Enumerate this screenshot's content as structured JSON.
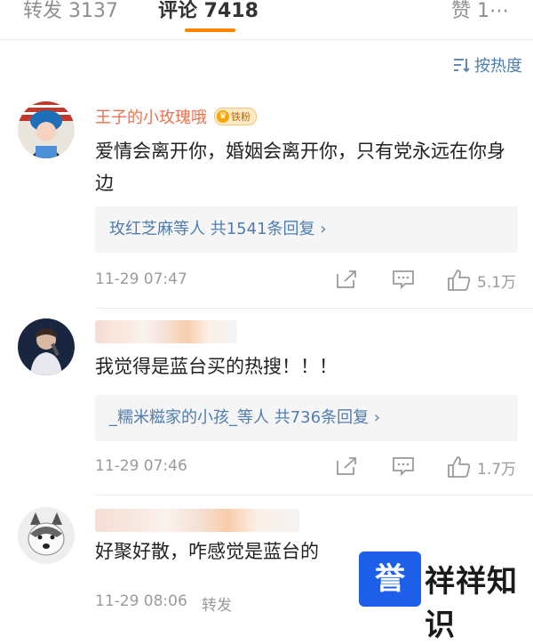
{
  "tabs": [
    {
      "label": "转发 3137"
    },
    {
      "label": "评论 7418"
    },
    {
      "label": "赞 1⋯"
    }
  ],
  "sort": {
    "label": "按热度"
  },
  "comments": [
    {
      "user": "王子的小玫瑰哦",
      "badge": "铁粉",
      "text": "爱情会离开你，婚姻会离开你，只有党永远在你身边",
      "replies": "玫红芝麻等人  共1541条回复 ›",
      "time": "11-29 07:47",
      "likes": "5.1万"
    },
    {
      "user": "",
      "text": "我觉得是蓝台买的热搜！！！",
      "replies": "_糯米糍家的小孩_等人  共736条回复 ›",
      "time": "11-29 07:46",
      "likes": "1.7万"
    },
    {
      "user": "",
      "text": "好聚好散，咋感觉是蓝台的",
      "time": "11-29 08:06",
      "extra": "转发"
    }
  ],
  "watermark": {
    "logo_char": "誉",
    "text": "祥祥知识",
    "color": "#1d5fe8"
  },
  "colors": {
    "accent": "#ff8200",
    "link": "#507daf",
    "username": "#eb7350"
  }
}
